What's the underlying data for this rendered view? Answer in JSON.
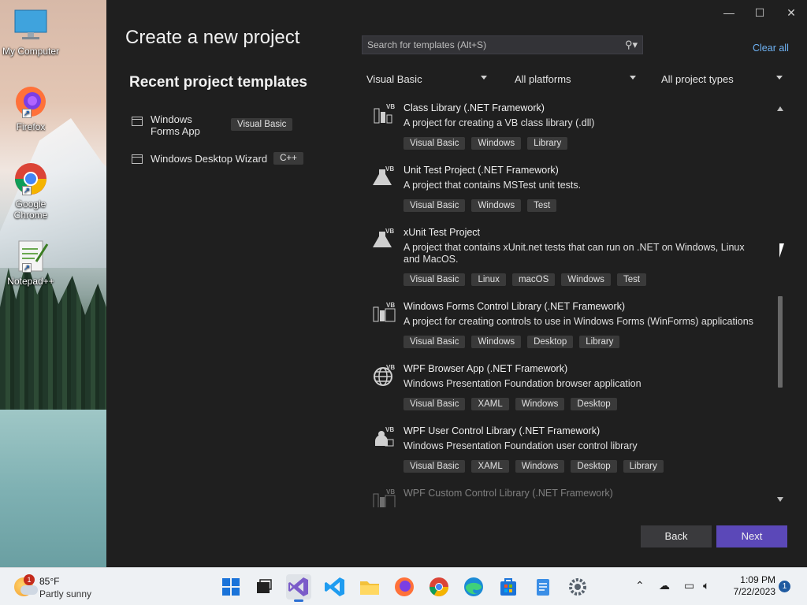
{
  "desktop": {
    "icons": [
      {
        "label": "My Computer"
      },
      {
        "label": "Firefox"
      },
      {
        "label": "Google Chrome"
      },
      {
        "label": "Notepad++"
      }
    ]
  },
  "window": {
    "title": "Create a new project",
    "recent_title": "Recent project templates",
    "recent": [
      {
        "name": "Windows Forms App",
        "lang": "Visual Basic"
      },
      {
        "name": "Windows Desktop Wizard",
        "lang": "C++"
      }
    ],
    "search_placeholder": "Search for templates (Alt+S)",
    "clear_all": "Clear all",
    "filters": {
      "language": "Visual Basic",
      "platform": "All platforms",
      "project_type": "All project types"
    },
    "templates": [
      {
        "name": "Class Library (.NET Framework)",
        "desc": "A project for creating a VB class library (.dll)",
        "tags": [
          "Visual Basic",
          "Windows",
          "Library"
        ]
      },
      {
        "name": "Unit Test Project (.NET Framework)",
        "desc": "A project that contains MSTest unit tests.",
        "tags": [
          "Visual Basic",
          "Windows",
          "Test"
        ]
      },
      {
        "name": "xUnit Test Project",
        "desc": "A project that contains xUnit.net tests that can run on .NET on Windows, Linux and MacOS.",
        "tags": [
          "Visual Basic",
          "Linux",
          "macOS",
          "Windows",
          "Test"
        ]
      },
      {
        "name": "Windows Forms Control Library (.NET Framework)",
        "desc": "A project for creating controls to use in Windows Forms (WinForms) applications",
        "tags": [
          "Visual Basic",
          "Windows",
          "Desktop",
          "Library"
        ]
      },
      {
        "name": "WPF Browser App (.NET Framework)",
        "desc": "Windows Presentation Foundation browser application",
        "tags": [
          "Visual Basic",
          "XAML",
          "Windows",
          "Desktop"
        ]
      },
      {
        "name": "WPF User Control Library (.NET Framework)",
        "desc": "Windows Presentation Foundation user control library",
        "tags": [
          "Visual Basic",
          "XAML",
          "Windows",
          "Desktop",
          "Library"
        ]
      },
      {
        "name": "WPF Custom Control Library (.NET Framework)"
      }
    ],
    "back_label": "Back",
    "next_label": "Next",
    "accent": "#5b48b8"
  },
  "taskbar": {
    "weather_temp": "85°F",
    "weather_cond": "Partly sunny",
    "weather_badge": "1",
    "time": "1:09 PM",
    "date": "7/22/2023",
    "notifications": "1"
  }
}
